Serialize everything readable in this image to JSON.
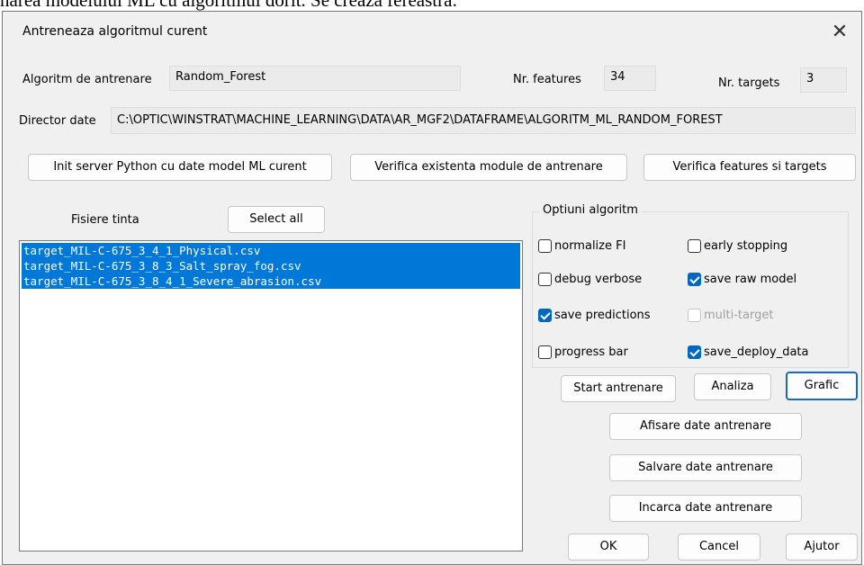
{
  "above_text": "narea modelului ML cu algoritmul dorit. Se creaza fereastra:",
  "dialog": {
    "title": "Antreneaza algoritmul curent",
    "close_symbol": "✕"
  },
  "algorithm": {
    "label": "Algoritm de antrenare",
    "value": "Random_Forest"
  },
  "features": {
    "label": "Nr. features",
    "value": "34"
  },
  "targets": {
    "label": "Nr. targets",
    "value": "3"
  },
  "data_dir": {
    "label": "Director date",
    "value": "C:\\OPTIC\\WINSTRAT\\MACHINE_LEARNING\\DATA\\AR_MGF2\\DATAFRAME\\ALGORITM_ML_RANDOM_FOREST"
  },
  "top_buttons": {
    "init_server": "Init server Python cu date model ML curent",
    "check_modules": "Verifica existenta module de antrenare",
    "check_features": "Verifica features si targets"
  },
  "target_files": {
    "label": "Fisiere tinta",
    "select_all": "Select all",
    "items": [
      "target_MIL-C-675_3_4_1_Physical.csv",
      "target_MIL-C-675_3_8_3_Salt_spray_fog.csv",
      "target_MIL-C-675_3_8_4_1_Severe_abrasion.csv"
    ]
  },
  "options": {
    "title": "Optiuni algoritm",
    "normalize_fi": {
      "label": "normalize FI",
      "checked": false
    },
    "early_stopping": {
      "label": "early stopping",
      "checked": false
    },
    "debug_verbose": {
      "label": "debug verbose",
      "checked": false
    },
    "save_raw_model": {
      "label": "save raw model",
      "checked": true
    },
    "save_predictions": {
      "label": "save predictions",
      "checked": true
    },
    "multi_target": {
      "label": "multi-target",
      "checked": false,
      "disabled": true
    },
    "progress_bar": {
      "label": "progress bar",
      "checked": false
    },
    "save_deploy_data": {
      "label": "save_deploy_data",
      "checked": true
    }
  },
  "actions": {
    "start": "Start antrenare",
    "analyze": "Analiza",
    "chart": "Grafic",
    "show_data": "Afisare date antrenare",
    "save_data": "Salvare date antrenare",
    "load_data": "Incarca date antrenare",
    "ok": "OK",
    "cancel": "Cancel",
    "help": "Ajutor"
  },
  "colors": {
    "dialog_bg": "#f0f0f0",
    "selection": "#0078d7",
    "checkbox_checked": "#0067c0",
    "default_button_border": "#1867c6"
  }
}
